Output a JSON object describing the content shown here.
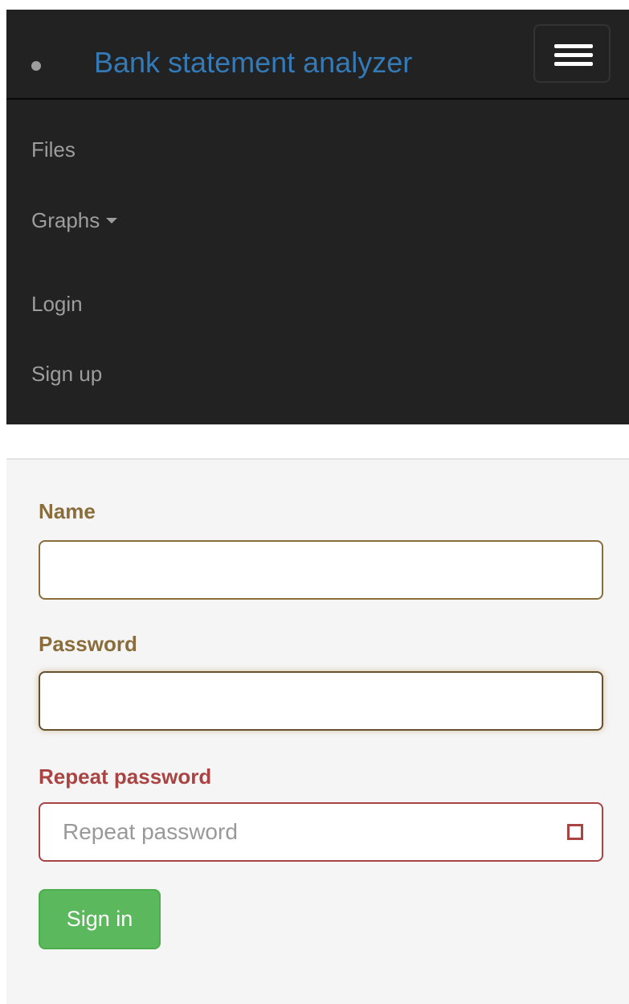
{
  "navbar": {
    "brand": "Bank statement analyzer",
    "toggle_icon": "hamburger-menu-icon",
    "items": [
      {
        "label": "Files"
      },
      {
        "label": "Graphs",
        "has_dropdown": true
      },
      {
        "label": "Login"
      },
      {
        "label": "Sign up"
      }
    ],
    "background_color": "#222222",
    "brand_color": "#337ab7",
    "item_color": "#9d9d9d"
  },
  "form": {
    "name_label": "Name",
    "name_value": "",
    "password_label": "Password",
    "password_value": "",
    "repeat_label": "Repeat password",
    "repeat_placeholder": "Repeat password",
    "repeat_value": "",
    "error_icon": "error-square-icon",
    "submit_label": "Sign in",
    "warning_color": "#8a6d3b",
    "error_color": "#a94442",
    "submit_color": "#5cb85c"
  }
}
